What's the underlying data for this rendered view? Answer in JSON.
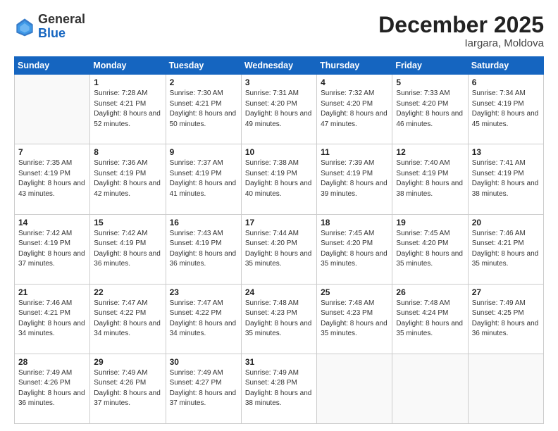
{
  "logo": {
    "general": "General",
    "blue": "Blue"
  },
  "header": {
    "month": "December 2025",
    "location": "Iargara, Moldova"
  },
  "days_header": [
    "Sunday",
    "Monday",
    "Tuesday",
    "Wednesday",
    "Thursday",
    "Friday",
    "Saturday"
  ],
  "weeks": [
    [
      {
        "day": "",
        "sunrise": "",
        "sunset": "",
        "daylight": ""
      },
      {
        "day": "1",
        "sunrise": "Sunrise: 7:28 AM",
        "sunset": "Sunset: 4:21 PM",
        "daylight": "Daylight: 8 hours and 52 minutes."
      },
      {
        "day": "2",
        "sunrise": "Sunrise: 7:30 AM",
        "sunset": "Sunset: 4:21 PM",
        "daylight": "Daylight: 8 hours and 50 minutes."
      },
      {
        "day": "3",
        "sunrise": "Sunrise: 7:31 AM",
        "sunset": "Sunset: 4:20 PM",
        "daylight": "Daylight: 8 hours and 49 minutes."
      },
      {
        "day": "4",
        "sunrise": "Sunrise: 7:32 AM",
        "sunset": "Sunset: 4:20 PM",
        "daylight": "Daylight: 8 hours and 47 minutes."
      },
      {
        "day": "5",
        "sunrise": "Sunrise: 7:33 AM",
        "sunset": "Sunset: 4:20 PM",
        "daylight": "Daylight: 8 hours and 46 minutes."
      },
      {
        "day": "6",
        "sunrise": "Sunrise: 7:34 AM",
        "sunset": "Sunset: 4:19 PM",
        "daylight": "Daylight: 8 hours and 45 minutes."
      }
    ],
    [
      {
        "day": "7",
        "sunrise": "Sunrise: 7:35 AM",
        "sunset": "Sunset: 4:19 PM",
        "daylight": "Daylight: 8 hours and 43 minutes."
      },
      {
        "day": "8",
        "sunrise": "Sunrise: 7:36 AM",
        "sunset": "Sunset: 4:19 PM",
        "daylight": "Daylight: 8 hours and 42 minutes."
      },
      {
        "day": "9",
        "sunrise": "Sunrise: 7:37 AM",
        "sunset": "Sunset: 4:19 PM",
        "daylight": "Daylight: 8 hours and 41 minutes."
      },
      {
        "day": "10",
        "sunrise": "Sunrise: 7:38 AM",
        "sunset": "Sunset: 4:19 PM",
        "daylight": "Daylight: 8 hours and 40 minutes."
      },
      {
        "day": "11",
        "sunrise": "Sunrise: 7:39 AM",
        "sunset": "Sunset: 4:19 PM",
        "daylight": "Daylight: 8 hours and 39 minutes."
      },
      {
        "day": "12",
        "sunrise": "Sunrise: 7:40 AM",
        "sunset": "Sunset: 4:19 PM",
        "daylight": "Daylight: 8 hours and 38 minutes."
      },
      {
        "day": "13",
        "sunrise": "Sunrise: 7:41 AM",
        "sunset": "Sunset: 4:19 PM",
        "daylight": "Daylight: 8 hours and 38 minutes."
      }
    ],
    [
      {
        "day": "14",
        "sunrise": "Sunrise: 7:42 AM",
        "sunset": "Sunset: 4:19 PM",
        "daylight": "Daylight: 8 hours and 37 minutes."
      },
      {
        "day": "15",
        "sunrise": "Sunrise: 7:42 AM",
        "sunset": "Sunset: 4:19 PM",
        "daylight": "Daylight: 8 hours and 36 minutes."
      },
      {
        "day": "16",
        "sunrise": "Sunrise: 7:43 AM",
        "sunset": "Sunset: 4:19 PM",
        "daylight": "Daylight: 8 hours and 36 minutes."
      },
      {
        "day": "17",
        "sunrise": "Sunrise: 7:44 AM",
        "sunset": "Sunset: 4:20 PM",
        "daylight": "Daylight: 8 hours and 35 minutes."
      },
      {
        "day": "18",
        "sunrise": "Sunrise: 7:45 AM",
        "sunset": "Sunset: 4:20 PM",
        "daylight": "Daylight: 8 hours and 35 minutes."
      },
      {
        "day": "19",
        "sunrise": "Sunrise: 7:45 AM",
        "sunset": "Sunset: 4:20 PM",
        "daylight": "Daylight: 8 hours and 35 minutes."
      },
      {
        "day": "20",
        "sunrise": "Sunrise: 7:46 AM",
        "sunset": "Sunset: 4:21 PM",
        "daylight": "Daylight: 8 hours and 35 minutes."
      }
    ],
    [
      {
        "day": "21",
        "sunrise": "Sunrise: 7:46 AM",
        "sunset": "Sunset: 4:21 PM",
        "daylight": "Daylight: 8 hours and 34 minutes."
      },
      {
        "day": "22",
        "sunrise": "Sunrise: 7:47 AM",
        "sunset": "Sunset: 4:22 PM",
        "daylight": "Daylight: 8 hours and 34 minutes."
      },
      {
        "day": "23",
        "sunrise": "Sunrise: 7:47 AM",
        "sunset": "Sunset: 4:22 PM",
        "daylight": "Daylight: 8 hours and 34 minutes."
      },
      {
        "day": "24",
        "sunrise": "Sunrise: 7:48 AM",
        "sunset": "Sunset: 4:23 PM",
        "daylight": "Daylight: 8 hours and 35 minutes."
      },
      {
        "day": "25",
        "sunrise": "Sunrise: 7:48 AM",
        "sunset": "Sunset: 4:23 PM",
        "daylight": "Daylight: 8 hours and 35 minutes."
      },
      {
        "day": "26",
        "sunrise": "Sunrise: 7:48 AM",
        "sunset": "Sunset: 4:24 PM",
        "daylight": "Daylight: 8 hours and 35 minutes."
      },
      {
        "day": "27",
        "sunrise": "Sunrise: 7:49 AM",
        "sunset": "Sunset: 4:25 PM",
        "daylight": "Daylight: 8 hours and 36 minutes."
      }
    ],
    [
      {
        "day": "28",
        "sunrise": "Sunrise: 7:49 AM",
        "sunset": "Sunset: 4:26 PM",
        "daylight": "Daylight: 8 hours and 36 minutes."
      },
      {
        "day": "29",
        "sunrise": "Sunrise: 7:49 AM",
        "sunset": "Sunset: 4:26 PM",
        "daylight": "Daylight: 8 hours and 37 minutes."
      },
      {
        "day": "30",
        "sunrise": "Sunrise: 7:49 AM",
        "sunset": "Sunset: 4:27 PM",
        "daylight": "Daylight: 8 hours and 37 minutes."
      },
      {
        "day": "31",
        "sunrise": "Sunrise: 7:49 AM",
        "sunset": "Sunset: 4:28 PM",
        "daylight": "Daylight: 8 hours and 38 minutes."
      },
      {
        "day": "",
        "sunrise": "",
        "sunset": "",
        "daylight": ""
      },
      {
        "day": "",
        "sunrise": "",
        "sunset": "",
        "daylight": ""
      },
      {
        "day": "",
        "sunrise": "",
        "sunset": "",
        "daylight": ""
      }
    ]
  ]
}
